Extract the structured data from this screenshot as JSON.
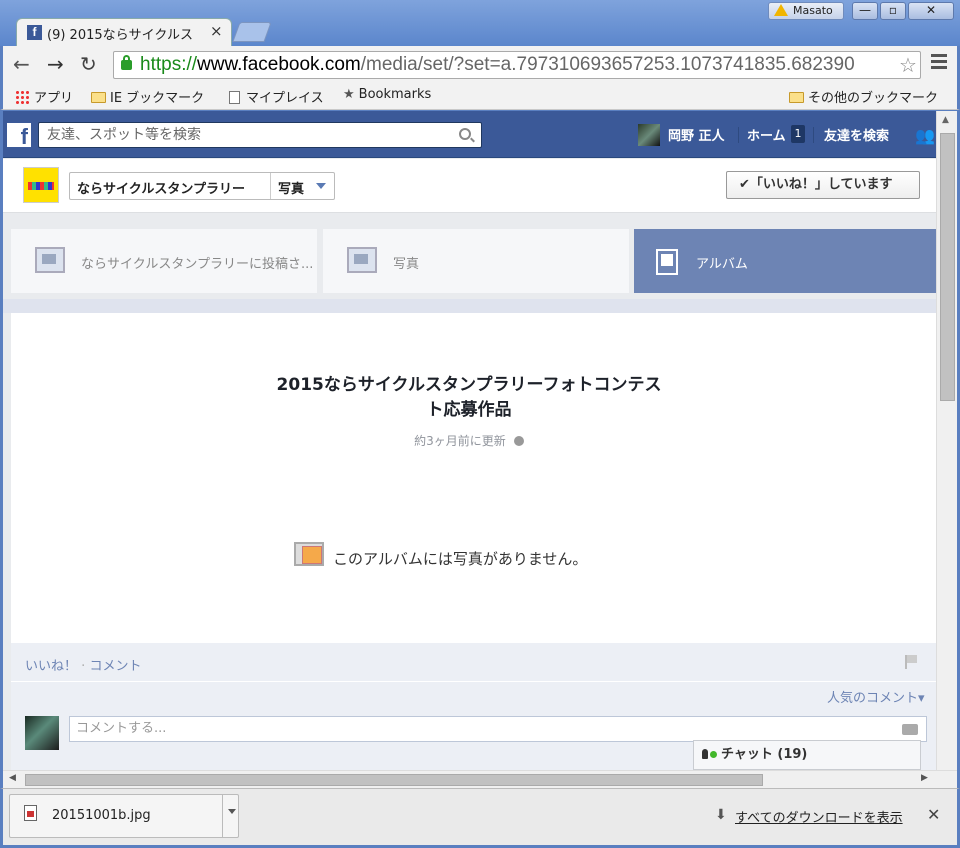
{
  "window": {
    "tab_title": "(9) 2015ならサイクルス",
    "tab_favicon": "f",
    "user_name": "Masato",
    "min_label": "—",
    "max_label": "▫",
    "close_label": "✕"
  },
  "toolbar": {
    "back_icon": "←",
    "forward_icon": "→",
    "reload_icon": "↻",
    "url_scheme": "https://",
    "url_host": "www.facebook.com",
    "url_path": "/media/set/?set=a.797310693657253.1073741835.682390",
    "star_icon": "☆"
  },
  "bookmarks": {
    "apps": "アプリ",
    "ie": "IE ブックマーク",
    "myplaces": "マイプレイス",
    "bookmarks": "Bookmarks",
    "other": "その他のブックマーク"
  },
  "fb": {
    "logo": "f",
    "search_placeholder": "友達、スポット等を検索",
    "user": "岡野 正人",
    "home": "ホーム",
    "home_count": "1",
    "find_friends": "友達を検索"
  },
  "page_header": {
    "page_name": "ならサイクルスタンプラリー",
    "section": "写真",
    "like_button": "✔「いいね！」しています"
  },
  "tabs": [
    {
      "label": "ならサイクルスタンプラリーに投稿さ..."
    },
    {
      "label": "写真"
    },
    {
      "label": "アルバム"
    }
  ],
  "album": {
    "title_line1": "2015ならサイクルスタンプラリーフォトコンテス",
    "title_line2": "ト応募作品",
    "updated": "約3ヶ月前に更新",
    "empty_message": "このアルバムには写真がありません。"
  },
  "ufi": {
    "like": "いいね！",
    "separator": "·",
    "comment": "コメント",
    "top_comments": "人気のコメント▾",
    "comment_placeholder": "コメントする..."
  },
  "chat": {
    "label": "チャット (19)"
  },
  "downloads": {
    "file_name": "20151001b.jpg",
    "show_all": "すべてのダウンロードを表示",
    "close_icon": "✕"
  }
}
